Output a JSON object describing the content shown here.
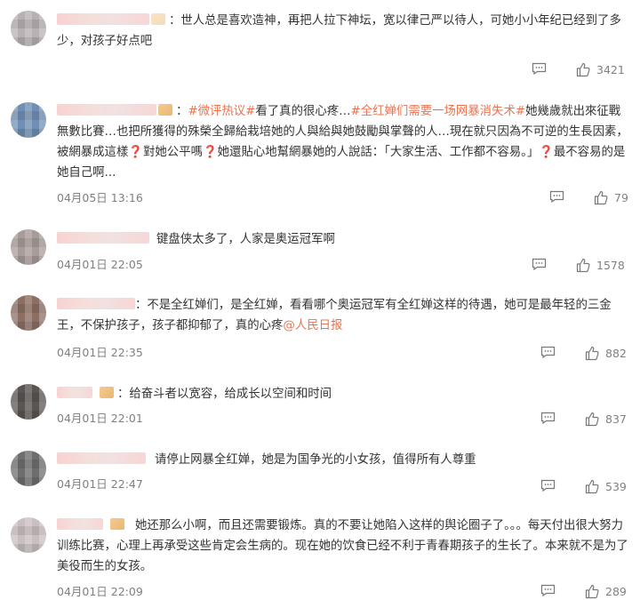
{
  "comments": [
    {
      "text_parts": [
        "：世人总是喜欢造神，再把人拉下神坛，宽以律己严以待人，可她小小年纪已经到了多少，对孩子好点吧"
      ],
      "time": "",
      "likes": "3421",
      "avatar_color": "#b8b0b4"
    },
    {
      "text_parts": [
        "：",
        "#微评热议#",
        "看了真的很心疼…",
        "#全红婵们需要一场网暴消失术#",
        "她幾歲就出來征戰無數比賽…也把所獲得的殊榮全歸給栽培她的人與給與她鼓勵與掌聲的人…現在就只因為不可逆的生長因素，被網暴成這樣",
        "❓",
        "對她公平嗎",
        "❓",
        "她還貼心地幫網暴她的人說話：「大家生活、工作都不容易。」",
        "❓",
        "最不容易的是她自己啊..."
      ],
      "time": "04月05日 13:16",
      "likes": "79",
      "avatar_color": "#6f8fb4"
    },
    {
      "text_parts": [
        "键盘侠太多了，人家是奥运冠军啊"
      ],
      "time": "04月01日 22:05",
      "likes": "1578",
      "avatar_color": "#a89c9a"
    },
    {
      "text_parts": [
        "：不是全红婵们，是全红婵，看看哪个奥运冠军有全红婵这样的待遇，她可是最年轻的三金王，不保护孩子，孩子都抑郁了，真的心疼",
        "@人民日报"
      ],
      "time": "04月01日 22:35",
      "likes": "882",
      "avatar_color": "#8c6e62"
    },
    {
      "text_parts": [
        "：给奋斗者以宽容，给成长以空间和时间"
      ],
      "time": "04月01日 22:01",
      "likes": "837",
      "avatar_color": "#5a5552"
    },
    {
      "text_parts": [
        "请停止网暴全红婵，她是为国争光的小女孩，值得所有人尊重"
      ],
      "time": "04月01日 22:47",
      "likes": "539",
      "avatar_color": "#6e6e6e"
    },
    {
      "text_parts": [
        "她还那么小啊，而且还需要锻炼。真的不要让她陷入这样的舆论圈子了。。。每天付出很大努力训练比赛，心理上再承受这些肯定会生病的。现在她的饮食已经不利于青春期孩子的生长了。本来就不是为了美役而生的女孩。"
      ],
      "time": "04月01日 22:09",
      "likes": "289",
      "avatar_color": "#c9bfc1"
    }
  ],
  "colors": {
    "text": "#333333",
    "meta": "#808080",
    "highlight": "#eb7350",
    "question": "#d0312d"
  }
}
